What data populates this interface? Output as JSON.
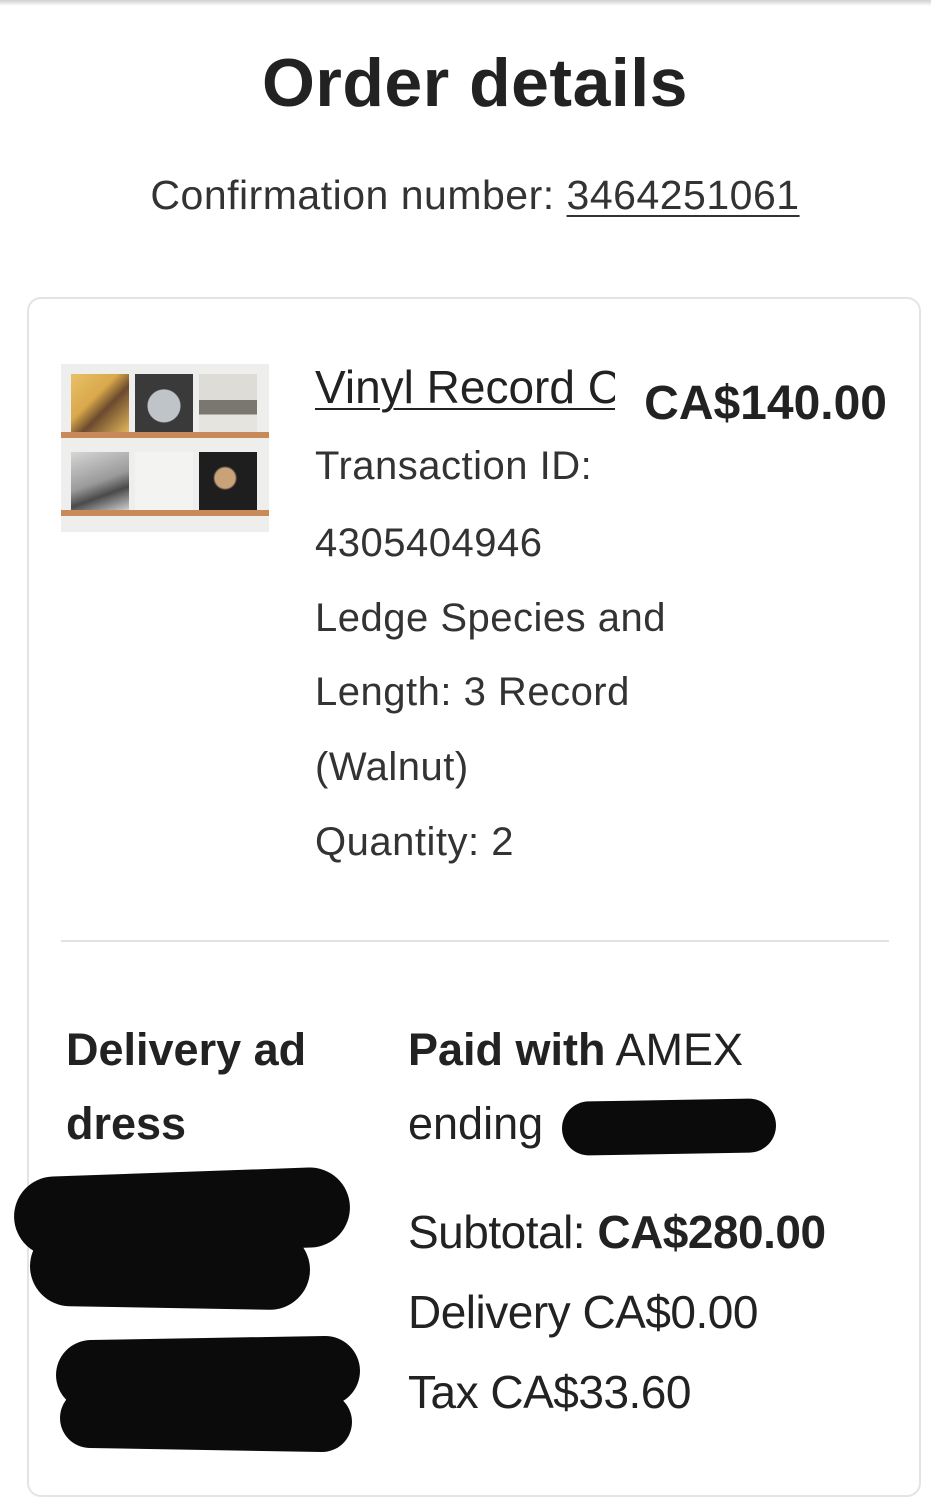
{
  "header": {
    "title": "Order details",
    "confirmation_label": "Confirmation number:",
    "confirmation_number": "3464251061"
  },
  "item": {
    "name": "Vinyl Record Col",
    "price": "CA$140.00",
    "transaction_label": "Transaction ID:",
    "transaction_id": "4305404946",
    "variation_line1": "Ledge Species and",
    "variation_line2": "Length: 3 Record",
    "variation_line3": "(Walnut)",
    "quantity": "Quantity: 2"
  },
  "delivery": {
    "heading_line1": "Delivery ad",
    "heading_line2": "dress"
  },
  "payment": {
    "paid_label": "Paid with",
    "paid_method": "AMEX",
    "ending_label": "ending",
    "subtotal_label": "Subtotal:",
    "subtotal_value": "CA$280.00",
    "delivery_label": "Delivery",
    "delivery_value": "CA$0.00",
    "tax_label": "Tax",
    "tax_value": "CA$33.60"
  },
  "colors": {
    "text": "#222222",
    "border": "#e4e4e4",
    "redaction": "#0b0b0b"
  }
}
